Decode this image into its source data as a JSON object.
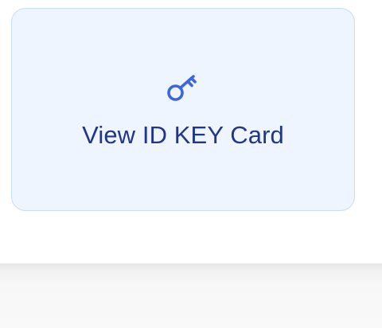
{
  "id_key_card": {
    "label": "View ID KEY Card",
    "icon": "key-icon",
    "accent_color": "#3a66e0",
    "text_color": "#20368a",
    "background_color": "#eff5fe",
    "border_color": "#c6ddf6"
  }
}
